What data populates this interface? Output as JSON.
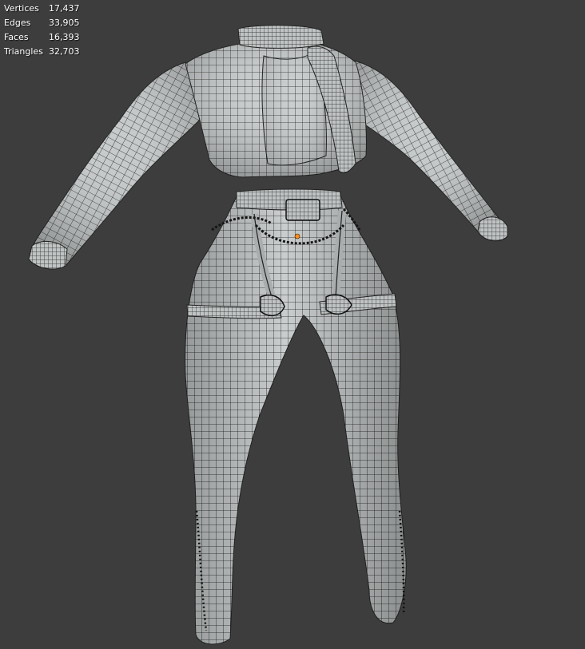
{
  "stats": {
    "rows": [
      {
        "label": "Vertices",
        "value": "17,437"
      },
      {
        "label": "Edges",
        "value": "33,905"
      },
      {
        "label": "Faces",
        "value": "16,393"
      },
      {
        "label": "Triangles",
        "value": "32,703"
      }
    ]
  },
  "colors": {
    "background": "#3d3d3d",
    "mesh_fill": "#c9cdcd",
    "wire": "#1c1c1c",
    "origin": "#ff8c1a"
  },
  "viewport": {
    "object": "outfit-mesh",
    "display_mode": "wireframe-overlay"
  }
}
